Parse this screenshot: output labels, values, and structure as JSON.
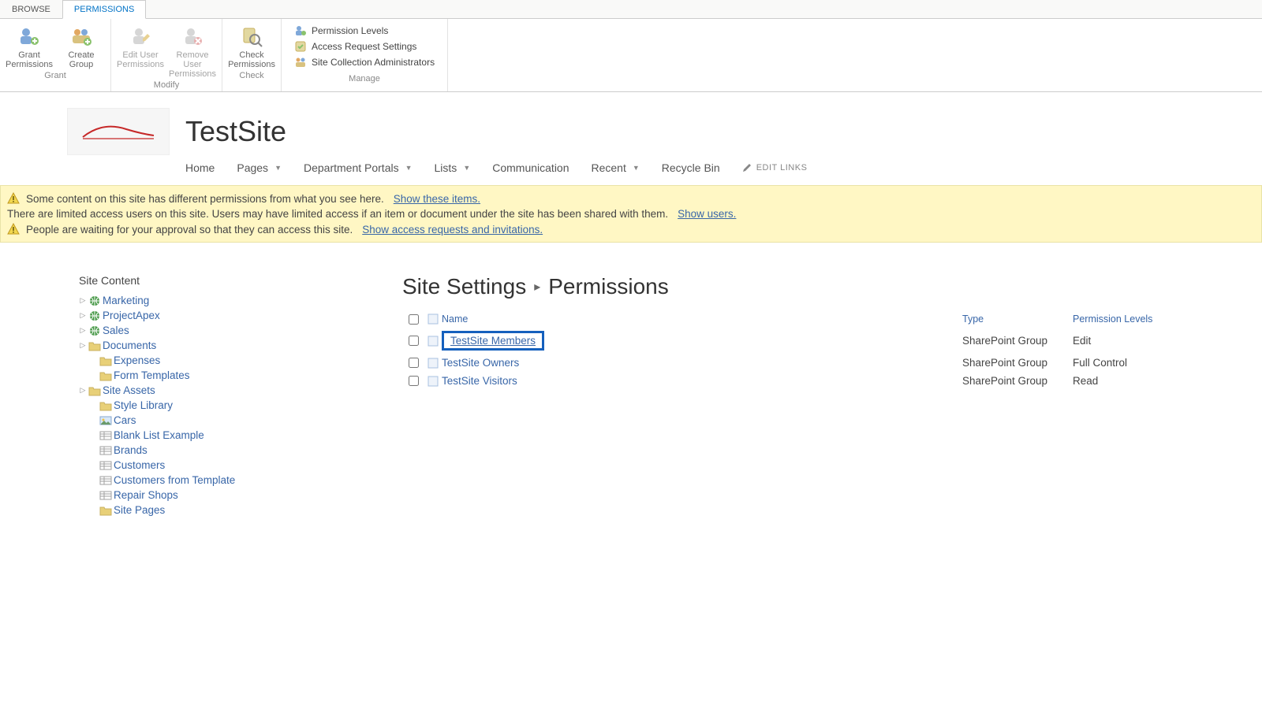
{
  "tabs": {
    "browse": "BROWSE",
    "permissions": "PERMISSIONS"
  },
  "ribbon": {
    "grant": {
      "grant_permissions": "Grant Permissions",
      "create_group": "Create Group",
      "label": "Grant"
    },
    "modify": {
      "edit_user": "Edit User Permissions",
      "remove_user": "Remove User Permissions",
      "label": "Modify"
    },
    "check": {
      "check_permissions": "Check Permissions",
      "label": "Check"
    },
    "manage": {
      "permission_levels": "Permission Levels",
      "access_request": "Access Request Settings",
      "site_collection_admins": "Site Collection Administrators",
      "label": "Manage"
    }
  },
  "header": {
    "site_title": "TestSite",
    "nav": {
      "home": "Home",
      "pages": "Pages",
      "department_portals": "Department Portals",
      "lists": "Lists",
      "communication": "Communication",
      "recent": "Recent",
      "recycle_bin": "Recycle Bin",
      "edit_links": "EDIT LINKS"
    }
  },
  "notifications": {
    "line1_text": "Some content on this site has different permissions from what you see here.",
    "line1_link": "Show these items.",
    "line2_text": "There are limited access users on this site. Users may have limited access if an item or document under the site has been shared with them.",
    "line2_link": "Show users.",
    "line3_text": "People are waiting for your approval so that they can access this site.",
    "line3_link": "Show access requests and invitations."
  },
  "sidebar": {
    "title": "Site Content",
    "items": [
      {
        "label": "Marketing",
        "type": "subsite",
        "expandable": true
      },
      {
        "label": "ProjectApex",
        "type": "subsite",
        "expandable": true
      },
      {
        "label": "Sales",
        "type": "subsite",
        "expandable": true
      },
      {
        "label": "Documents",
        "type": "library",
        "expandable": true
      },
      {
        "label": "Expenses",
        "type": "library",
        "child": true
      },
      {
        "label": "Form Templates",
        "type": "library",
        "child": true
      },
      {
        "label": "Site Assets",
        "type": "library",
        "expandable": true
      },
      {
        "label": "Style Library",
        "type": "library",
        "child": true
      },
      {
        "label": "Cars",
        "type": "piclib",
        "child": true
      },
      {
        "label": "Blank List Example",
        "type": "list",
        "child": true
      },
      {
        "label": "Brands",
        "type": "list",
        "child": true
      },
      {
        "label": "Customers",
        "type": "list",
        "child": true
      },
      {
        "label": "Customers from Template",
        "type": "list",
        "child": true
      },
      {
        "label": "Repair Shops",
        "type": "list",
        "child": true
      },
      {
        "label": "Site Pages",
        "type": "library",
        "child": true
      }
    ]
  },
  "content": {
    "breadcrumb": {
      "settings": "Site Settings",
      "current": "Permissions"
    },
    "columns": {
      "name": "Name",
      "type": "Type",
      "level": "Permission Levels"
    },
    "rows": [
      {
        "name": "TestSite Members",
        "type": "SharePoint Group",
        "level": "Edit",
        "highlighted": true
      },
      {
        "name": "TestSite Owners",
        "type": "SharePoint Group",
        "level": "Full Control"
      },
      {
        "name": "TestSite Visitors",
        "type": "SharePoint Group",
        "level": "Read"
      }
    ]
  }
}
